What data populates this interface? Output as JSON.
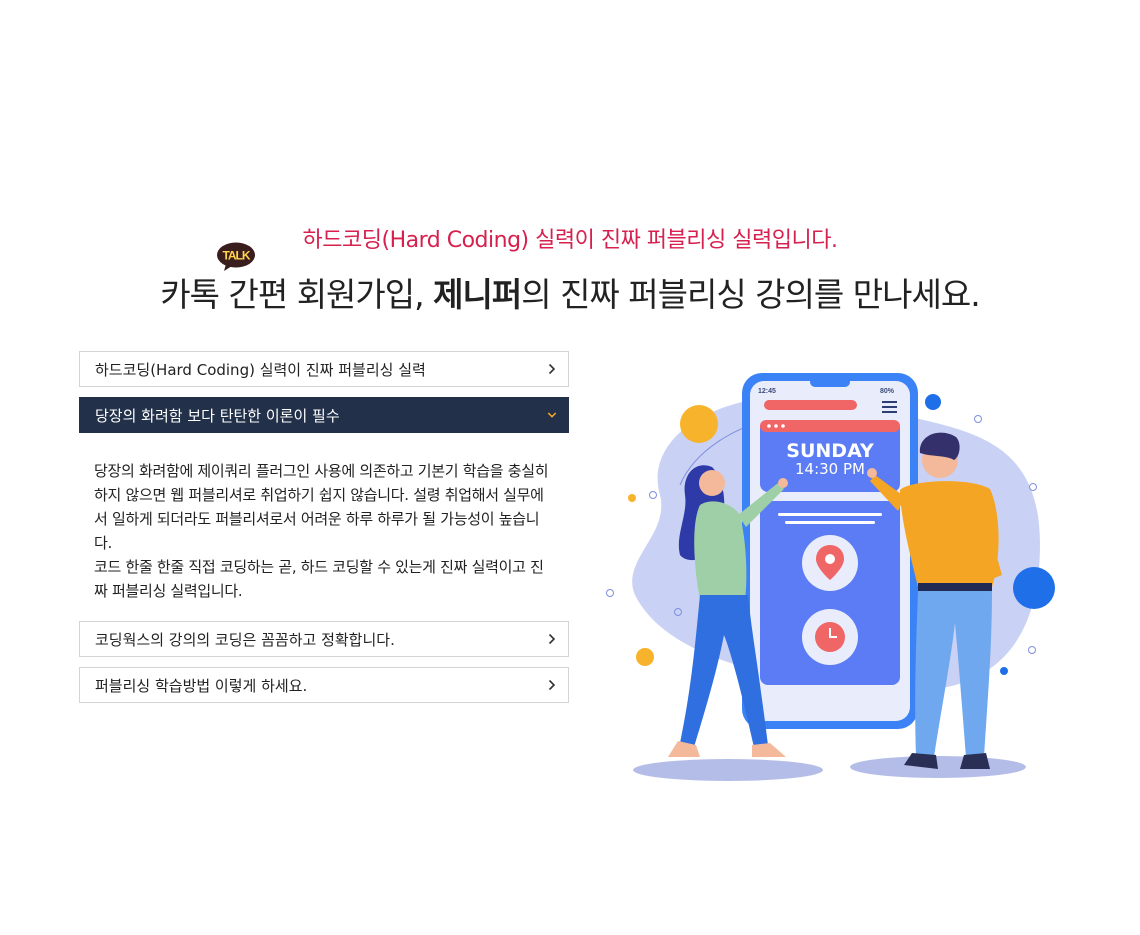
{
  "hero": {
    "subtitle": "하드코딩(Hard Coding) 실력이 진짜 퍼블리싱 실력입니다.",
    "headline_pre": "카톡",
    "talk_badge": "TALK",
    "headline_mid": " 간편 회원가입, ",
    "headline_bold": "제니퍼",
    "headline_post": "의 진짜 퍼블리싱 강의를 만나세요."
  },
  "accordion": {
    "items": [
      {
        "label": "하드코딩(Hard Coding) 실력이 진짜 퍼블리싱 실력"
      },
      {
        "label": "당장의 화려함 보다 탄탄한 이론이 필수"
      },
      {
        "label": "코딩웍스의 강의의 코딩은 꼼꼼하고 정확합니다."
      },
      {
        "label": "퍼블리싱 학습방법 이렇게 하세요."
      }
    ],
    "expanded_body_1": "당장의 화려함에 제이쿼리 플러그인 사용에 의존하고 기본기 학습을 충실히 하지 않으면 웹 퍼블리셔로 취업하기 쉽지 않습니다. 설령 취업해서 실무에서 일하게 되더라도 퍼블리셔로서 어려운 하루 하루가 될 가능성이 높습니다.",
    "expanded_body_2": "코드 한줄 한줄 직접 코딩하는 곧, 하드 코딩할 수 있는게 진짜 실력이고 진짜 퍼블리싱 실력입니다."
  },
  "phone": {
    "time": "12:45",
    "battery": "80%",
    "day": "SUNDAY",
    "clock": "14:30 PM"
  },
  "colors": {
    "accent_red": "#d6204e",
    "active_bg": "#22304a",
    "chevron_active": "#f5a623"
  },
  "icons": [
    "kakao-talk-icon",
    "chevron-right-icon",
    "chevron-down-icon",
    "menu-icon",
    "location-pin-icon",
    "clock-icon"
  ]
}
